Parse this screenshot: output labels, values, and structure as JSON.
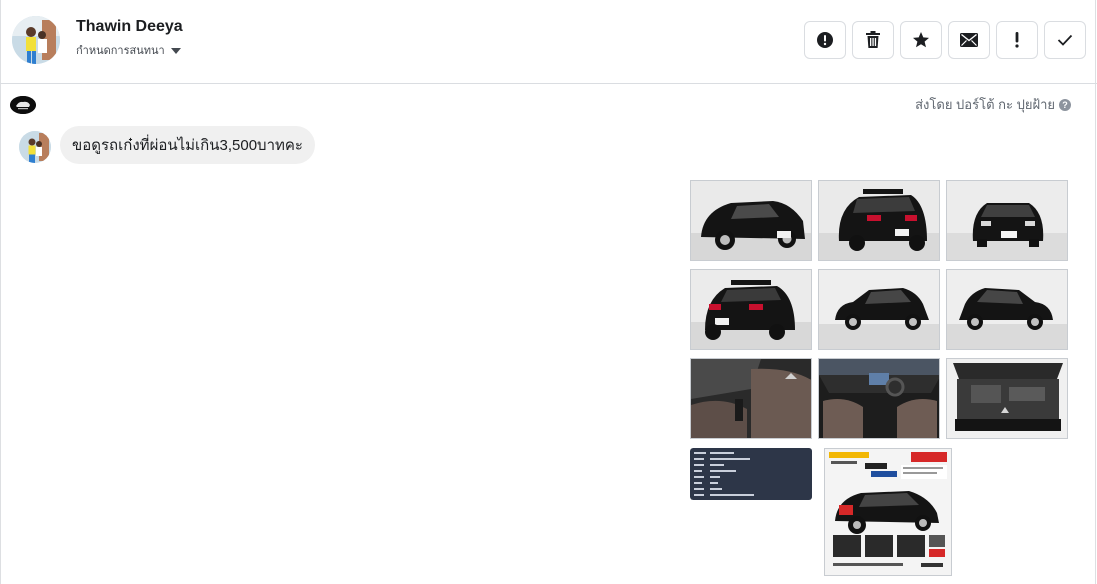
{
  "header": {
    "contact_name": "Thawin Deeya",
    "assign_label": "กำหนดการสนทนา",
    "actions": [
      {
        "name": "mark-spam-button",
        "icon": "alert-circle-icon"
      },
      {
        "name": "delete-button",
        "icon": "trash-icon"
      },
      {
        "name": "star-button",
        "icon": "star-icon"
      },
      {
        "name": "mark-unread-button",
        "icon": "envelope-icon"
      },
      {
        "name": "follow-up-button",
        "icon": "exclamation-icon"
      },
      {
        "name": "mark-done-button",
        "icon": "check-icon"
      }
    ]
  },
  "meta": {
    "sent_by": "ส่งโดย ปอร์โต้ กะ ปุยฝ้าย",
    "help_glyph": "?"
  },
  "message": {
    "text": "ขอดูรถเก๋งที่ผ่อนไม่เกิน3,500บาทคะ"
  },
  "photos": [
    {
      "name": "photo-car-front-left",
      "kind": "car-34"
    },
    {
      "name": "photo-car-rear-right",
      "kind": "car-rear"
    },
    {
      "name": "photo-car-front",
      "kind": "car-front"
    },
    {
      "name": "photo-car-rear-left",
      "kind": "car-rear"
    },
    {
      "name": "photo-car-side-left",
      "kind": "car-side"
    },
    {
      "name": "photo-car-side-right",
      "kind": "car-side"
    },
    {
      "name": "photo-interior-seats",
      "kind": "interior"
    },
    {
      "name": "photo-interior-dashboard",
      "kind": "dashboard"
    },
    {
      "name": "photo-engine-bay",
      "kind": "engine"
    },
    {
      "name": "photo-spec-sheet",
      "kind": "spec"
    },
    {
      "name": "photo-promo-poster",
      "kind": "poster"
    }
  ],
  "colors": {
    "bubble": "#f0f0f0",
    "border": "#dadde1",
    "car_body": "#141414",
    "spec_bg": "#2d3648"
  }
}
